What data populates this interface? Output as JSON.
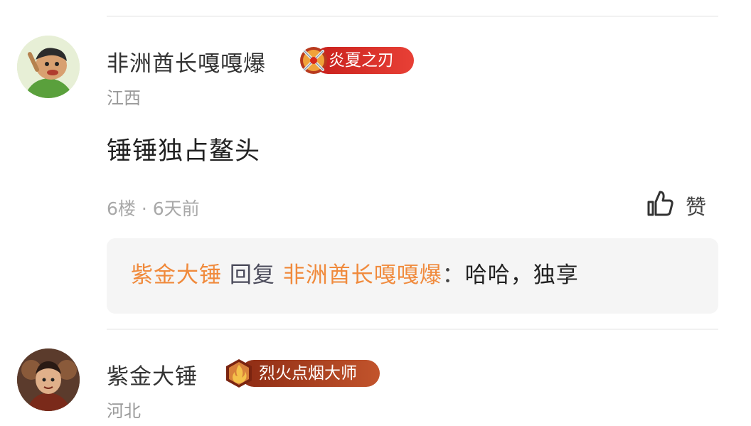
{
  "comment": {
    "username": "非洲酋长嘎嘎爆",
    "badge": "炎夏之刃",
    "location": "江西",
    "content": "锤锤独占鳌头",
    "meta": "6楼 · 6天前",
    "like_label": "赞",
    "reply": {
      "author": "紫金大锤",
      "verb": "回复",
      "target": "非洲酋长嘎嘎爆",
      "separator": "：",
      "text": "哈哈，独享"
    }
  },
  "next_comment": {
    "username": "紫金大锤",
    "badge": "烈火点烟大师",
    "location": "河北"
  },
  "colors": {
    "link_orange": "#f08a3c",
    "badge_red": "#e3322c",
    "badge_brown": "#9a3a1c"
  },
  "icons": [
    "avatar-image",
    "crossed-swords-emblem-icon",
    "thumbs-up-icon",
    "flame-emblem-icon"
  ]
}
